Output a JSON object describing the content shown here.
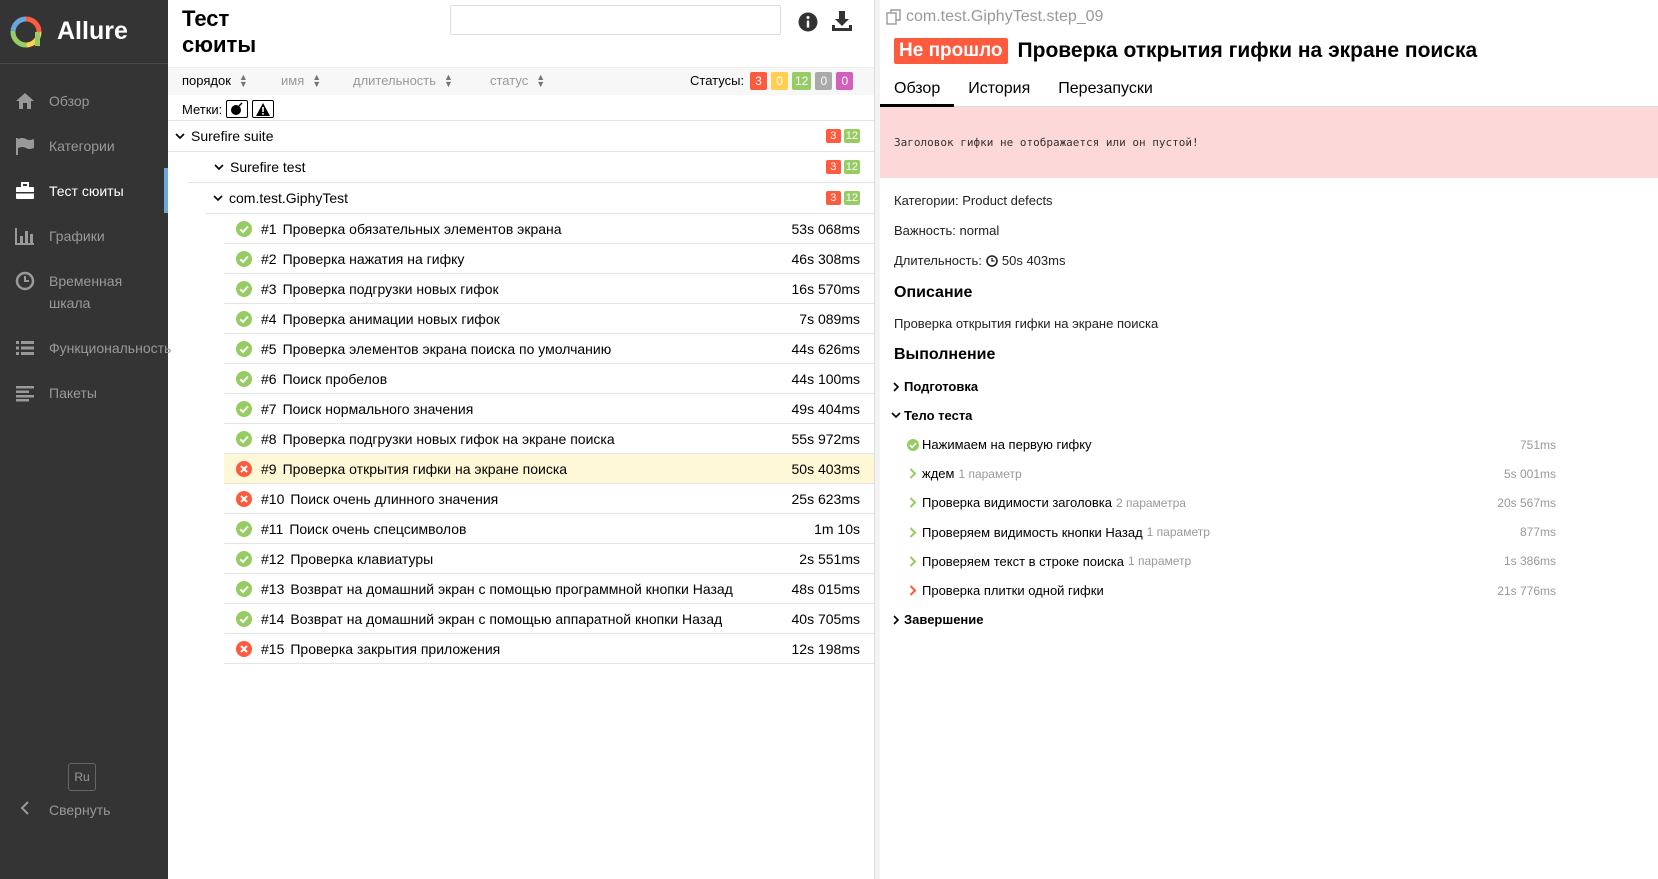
{
  "app": {
    "name": "Allure"
  },
  "sidebar": {
    "items": [
      {
        "label": "Обзор",
        "icon": "home-icon"
      },
      {
        "label": "Категории",
        "icon": "flag-icon"
      },
      {
        "label": "Тест сюиты",
        "icon": "briefcase-icon",
        "active": true
      },
      {
        "label": "Графики",
        "icon": "bar-chart-icon"
      },
      {
        "label": "Временная шкала",
        "icon": "clock-icon"
      },
      {
        "label": "Функциональность",
        "icon": "list-icon"
      },
      {
        "label": "Пакеты",
        "icon": "align-left-icon"
      }
    ],
    "lang": "Ru",
    "collapse_label": "Свернуть"
  },
  "middle": {
    "title": "Тест сюиты",
    "sort": {
      "order": "порядок",
      "name": "имя",
      "duration": "длительность",
      "status": "статус"
    },
    "statuses_label": "Статусы:",
    "status_counts": {
      "failed": "3",
      "broken": "0",
      "passed": "12",
      "skipped": "0",
      "unknown": "0"
    },
    "marks_label": "Метки:",
    "tree": {
      "groups": [
        {
          "name": "Surefire suite",
          "failed": "3",
          "passed": "12"
        },
        {
          "name": "Surefire test",
          "failed": "3",
          "passed": "12"
        },
        {
          "name": "com.test.GiphyTest",
          "failed": "3",
          "passed": "12"
        }
      ],
      "tests": [
        {
          "num": "#1",
          "name": "Проверка обязательных элементов экрана",
          "duration": "53s 068ms",
          "status": "passed"
        },
        {
          "num": "#2",
          "name": "Проверка нажатия на гифку",
          "duration": "46s 308ms",
          "status": "passed"
        },
        {
          "num": "#3",
          "name": "Проверка подгрузки новых гифок",
          "duration": "16s 570ms",
          "status": "passed"
        },
        {
          "num": "#4",
          "name": "Проверка анимации новых гифок",
          "duration": "7s 089ms",
          "status": "passed"
        },
        {
          "num": "#5",
          "name": "Проверка элементов экрана поиска по умолчанию",
          "duration": "44s 626ms",
          "status": "passed"
        },
        {
          "num": "#6",
          "name": "Поиск пробелов",
          "duration": "44s 100ms",
          "status": "passed"
        },
        {
          "num": "#7",
          "name": "Поиск нормального значения",
          "duration": "49s 404ms",
          "status": "passed"
        },
        {
          "num": "#8",
          "name": "Проверка подгрузки новых гифок на экране поиска",
          "duration": "55s 972ms",
          "status": "passed"
        },
        {
          "num": "#9",
          "name": "Проверка открытия гифки на экране поиска",
          "duration": "50s 403ms",
          "status": "failed",
          "selected": true
        },
        {
          "num": "#10",
          "name": "Поиск очень длинного значения",
          "duration": "25s 623ms",
          "status": "failed"
        },
        {
          "num": "#11",
          "name": "Поиск очень спецсимволов",
          "duration": "1m 10s",
          "status": "passed"
        },
        {
          "num": "#12",
          "name": "Проверка клавиатуры",
          "duration": "2s 551ms",
          "status": "passed"
        },
        {
          "num": "#13",
          "name": "Возврат на домашний экран с помощью программной кнопки Назад",
          "duration": "48s 015ms",
          "status": "passed"
        },
        {
          "num": "#14",
          "name": "Возврат на домашний экран с помощью аппаратной кнопки Назад",
          "duration": "40s 705ms",
          "status": "passed"
        },
        {
          "num": "#15",
          "name": "Проверка закрытия приложения",
          "duration": "12s 198ms",
          "status": "failed"
        }
      ]
    }
  },
  "detail": {
    "breadcrumb": "com.test.GiphyTest.step_09",
    "status_badge": "Не прошло",
    "title": "Проверка открытия гифки на экране поиска",
    "tabs": [
      "Обзор",
      "История",
      "Перезапуски"
    ],
    "error_message": "Заголовок гифки не отображается или он пустой!",
    "category_label": "Категории:",
    "category": "Product defects",
    "severity_label": "Важность:",
    "severity": "normal",
    "duration_label": "Длительность:",
    "duration": "50s 403ms",
    "description_heading": "Описание",
    "description": "Проверка открытия гифки на экране поиска",
    "execution_heading": "Выполнение",
    "setup_label": "Подготовка",
    "body_label": "Тело теста",
    "teardown_label": "Завершение",
    "steps": [
      {
        "name": "Нажимаем на первую гифку",
        "param": "",
        "duration": "751ms",
        "status": "passed"
      },
      {
        "name": "ждем",
        "param": "1 параметр",
        "duration": "5s 001ms",
        "status": "passed"
      },
      {
        "name": "Проверка видимости заголовка",
        "param": "2 параметра",
        "duration": "20s 567ms",
        "status": "passed"
      },
      {
        "name": "Проверяем видимость кнопки Назад",
        "param": "1 параметр",
        "duration": "877ms",
        "status": "passed"
      },
      {
        "name": "Проверяем текст в строке поиска",
        "param": "1 параметр",
        "duration": "1s 386ms",
        "status": "passed"
      },
      {
        "name": "Проверка плитки одной гифки",
        "param": "",
        "duration": "21s 776ms",
        "status": "failed"
      }
    ]
  },
  "colors": {
    "passed": "#97cc64",
    "failed": "#fd5a3e",
    "sidebar": "#343434",
    "selected_row": "#fff8d6",
    "error_bg": "#fdd8d8"
  }
}
